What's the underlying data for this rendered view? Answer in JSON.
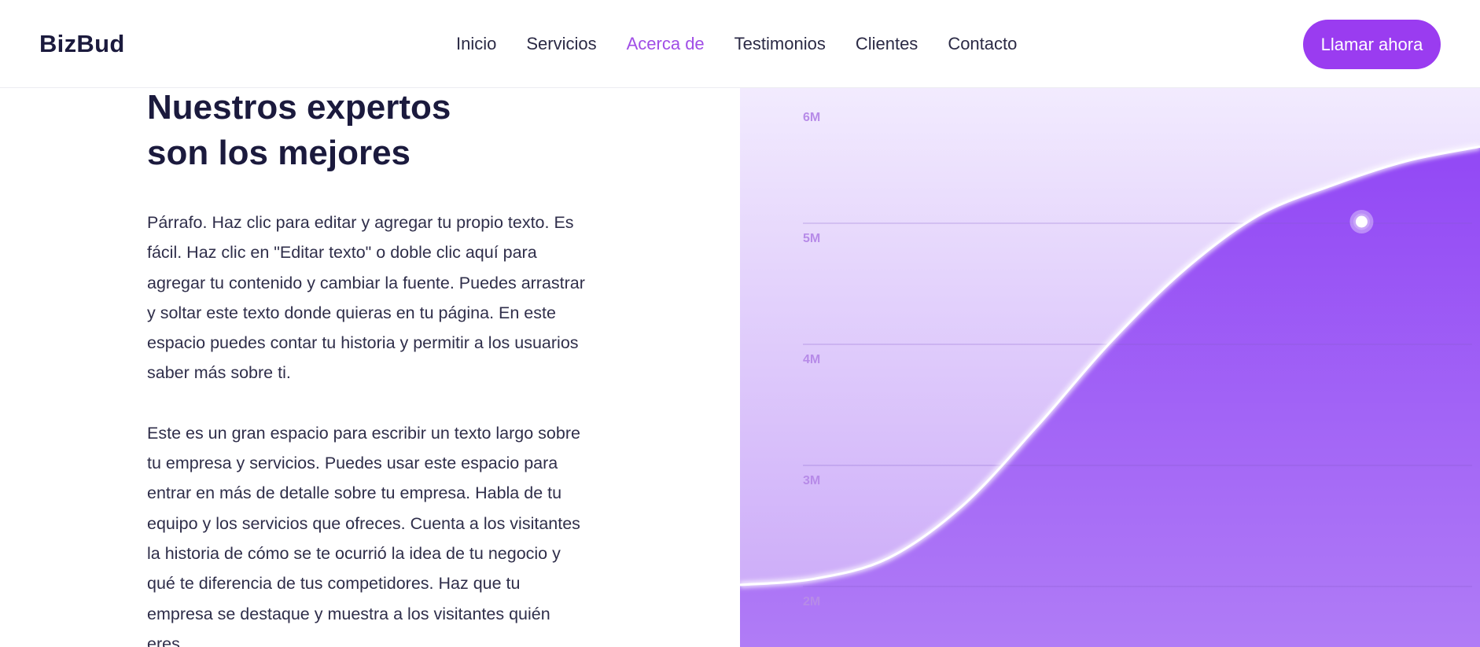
{
  "header": {
    "brand": "BizBud",
    "nav": [
      {
        "label": "Inicio",
        "active": false
      },
      {
        "label": "Servicios",
        "active": false
      },
      {
        "label": "Acerca de",
        "active": true
      },
      {
        "label": "Testimonios",
        "active": false
      },
      {
        "label": "Clientes",
        "active": false
      },
      {
        "label": "Contacto",
        "active": false
      }
    ],
    "cta_label": "Llamar ahora"
  },
  "main": {
    "heading_line1": "Nuestros expertos",
    "heading_line2": "son los mejores",
    "paragraph1": "Párrafo. Haz clic para editar y agregar tu propio texto. Es fácil. Haz clic en \"Editar texto\" o doble clic aquí para agregar tu contenido y cambiar la fuente. Puedes arrastrar y soltar este texto donde quieras en tu página. En este espacio puedes contar tu historia y permitir a los usuarios saber más sobre ti.",
    "paragraph2": "Este es un gran espacio para escribir un texto largo sobre tu empresa y servicios. Puedes usar este espacio para entrar en más de detalle sobre tu empresa. Habla de tu equipo y los servicios que ofreces. Cuenta a los visitantes la historia de cómo se te ocurrió la idea de tu negocio y qué te diferencia de tus competidores. Haz que tu empresa se destaque y muestra a los visitantes quién eres."
  },
  "colors": {
    "accent": "#9a3cf0",
    "nav_active": "#a04ee6",
    "text_dark": "#1b1a3d",
    "chart_fill": "#9b59f5",
    "chart_bg_top": "#f2ebfe",
    "chart_bg_bottom": "#c9a6f8",
    "axis_label": "#b78be8"
  },
  "chart_data": {
    "type": "area",
    "yticks": [
      "6M",
      "5M",
      "4M",
      "3M",
      "2M"
    ],
    "ylim": [
      2,
      6
    ],
    "grid": true,
    "x": [
      0,
      0.1,
      0.2,
      0.3,
      0.4,
      0.5,
      0.6,
      0.7,
      0.8,
      0.9,
      1.0
    ],
    "values": [
      2.0,
      2.05,
      2.22,
      2.65,
      3.3,
      4.0,
      4.6,
      5.05,
      5.3,
      5.5,
      5.62
    ],
    "highlight": {
      "x": 0.84,
      "value": 5.0
    }
  }
}
